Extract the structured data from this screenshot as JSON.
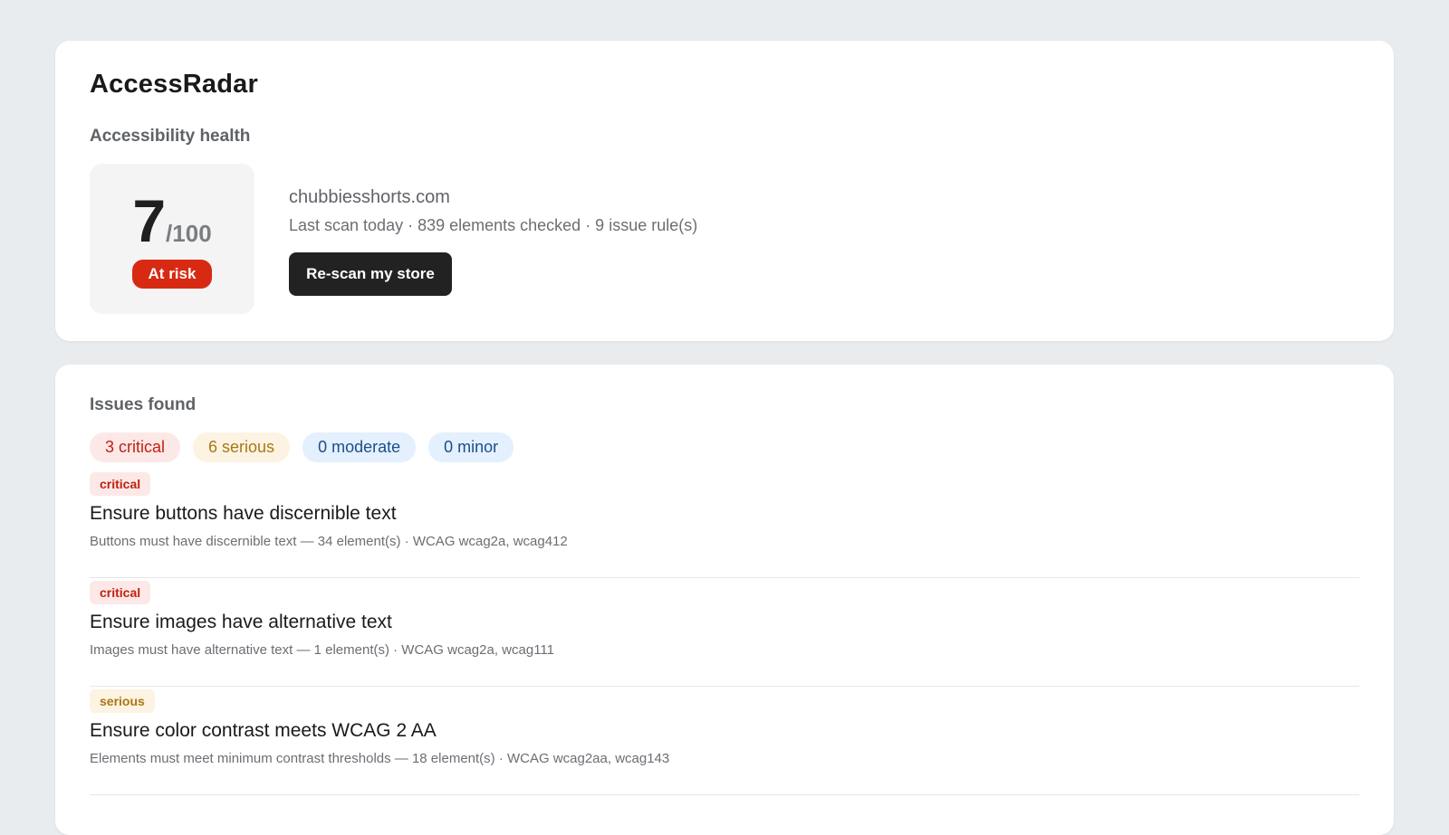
{
  "app": {
    "title": "AccessRadar"
  },
  "health": {
    "heading": "Accessibility health",
    "score": "7",
    "score_max": "/100",
    "status": "At risk",
    "domain": "chubbiesshorts.com",
    "scan_meta": "Last scan today · 839 elements checked · 9 issue rule(s)",
    "rescan_label": "Re-scan my store"
  },
  "issues": {
    "heading": "Issues found",
    "summary": {
      "critical": "3 critical",
      "serious": "6 serious",
      "moderate": "0 moderate",
      "minor": "0 minor"
    },
    "items": [
      {
        "severity": "critical",
        "title": "Ensure buttons have discernible text",
        "detail": "Buttons must have discernible text — 34 element(s) · WCAG wcag2a, wcag412"
      },
      {
        "severity": "critical",
        "title": "Ensure images have alternative text",
        "detail": "Images must have alternative text — 1 element(s) · WCAG wcag2a, wcag111"
      },
      {
        "severity": "serious",
        "title": "Ensure color contrast meets WCAG 2 AA",
        "detail": "Elements must meet minimum contrast thresholds — 18 element(s) · WCAG wcag2aa, wcag143"
      }
    ]
  },
  "colors": {
    "page_background": "#e9ecef",
    "at_risk": "#d82a12",
    "critical_text": "#c0220f",
    "critical_bg": "#fde8e8",
    "serious_text": "#a97813",
    "serious_bg": "#fdf3e3",
    "info_text": "#1a4f8c",
    "info_bg": "#e4f0fd",
    "primary_button": "#222222"
  }
}
